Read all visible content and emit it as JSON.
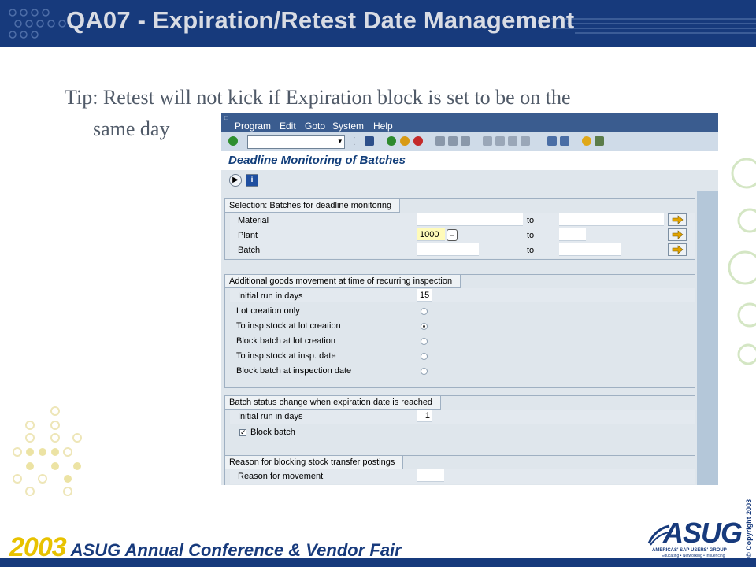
{
  "slide": {
    "title": "QA07 - Expiration/Retest Date Management",
    "tip_line1": "Tip: Retest will not kick if Expiration block is set to be on the",
    "tip_line2": "same day"
  },
  "sap": {
    "menu": [
      {
        "label": "Program"
      },
      {
        "label": "Edit"
      },
      {
        "label": "Goto"
      },
      {
        "label": "System"
      },
      {
        "label": "Help"
      }
    ],
    "command_field_value": "",
    "screen_title": "Deadline Monitoring of Batches",
    "section_selection": {
      "title": "Selection: Batches for deadline monitoring",
      "rows": [
        {
          "label": "Material",
          "from": "",
          "to_label": "to",
          "to": ""
        },
        {
          "label": "Plant",
          "from": "1000",
          "to_label": "to",
          "to": ""
        },
        {
          "label": "Batch",
          "from": "",
          "to_label": "to",
          "to": ""
        }
      ]
    },
    "section_goods": {
      "title": "Additional goods movement at time of recurring inspection",
      "initial_run_label": "Initial run in days",
      "initial_run_value": "15",
      "options": [
        {
          "label": "Lot creation only",
          "selected": false
        },
        {
          "label": "To insp.stock at lot creation",
          "selected": true
        },
        {
          "label": "Block batch at lot creation",
          "selected": false
        },
        {
          "label": "To insp.stock at insp. date",
          "selected": false
        },
        {
          "label": "Block batch at inspection date",
          "selected": false
        }
      ]
    },
    "section_status": {
      "title": "Batch status change when expiration date is reached",
      "initial_run_label": "Initial run in days",
      "initial_run_value": "1",
      "block_batch_label": "Block batch",
      "block_batch_checked": true
    },
    "section_reason": {
      "title": "Reason for blocking stock transfer postings",
      "reason_label": "Reason for movement",
      "reason_value": ""
    }
  },
  "footer": {
    "year": "2003",
    "conference": "ASUG Annual Conference & Vendor Fair",
    "logo": "ASUG",
    "logo_tagline": "AMERICAS' SAP USERS' GROUP",
    "logo_tagline2": "Educating • Networking • Influencing",
    "copyright": "© Copyright 2003"
  },
  "colors": {
    "navy": "#173a7c",
    "sap_menu": "#3a5c8f",
    "sap_bg": "#dfe6ec",
    "gold": "#e8c200",
    "highlight_field": "#fffbb9"
  }
}
